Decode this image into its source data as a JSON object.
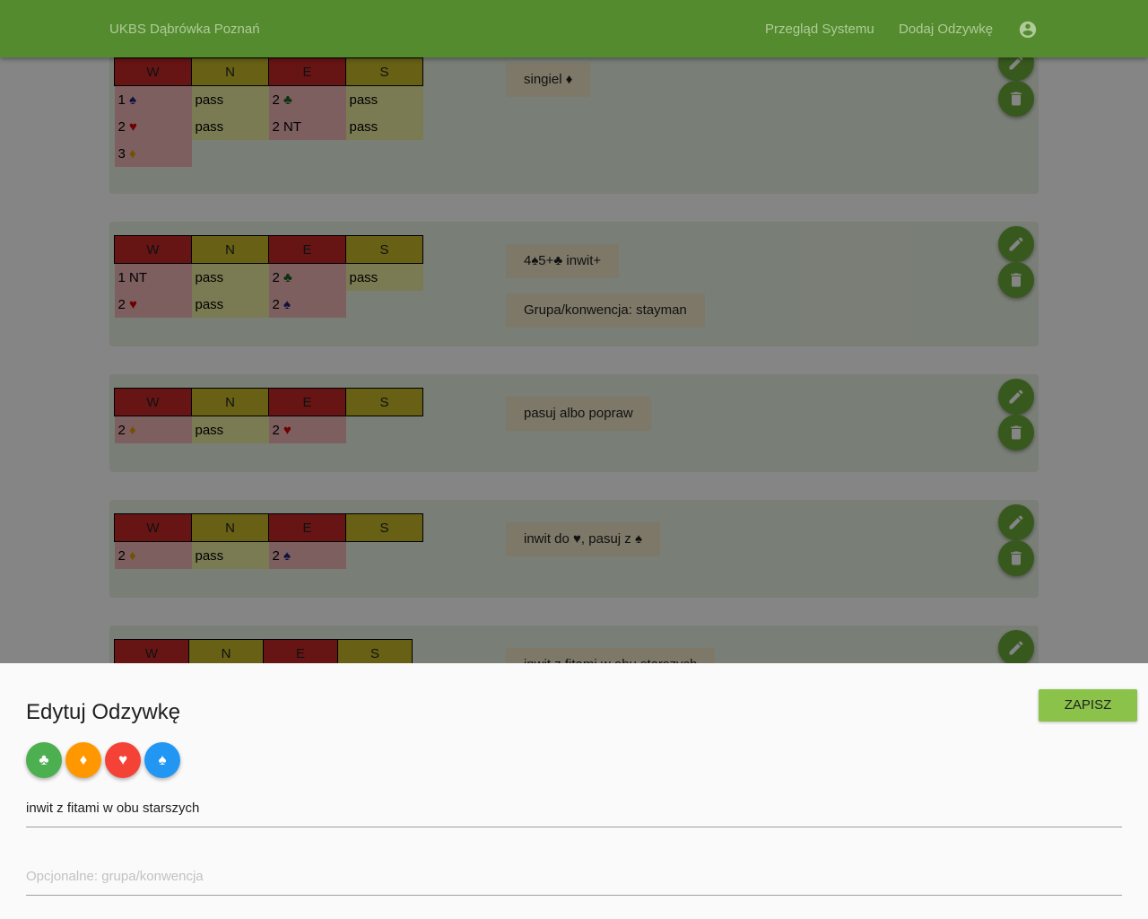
{
  "header": {
    "brand": "UKBS Dąbrówka Poznań",
    "nav": [
      "Przegląd Systemu",
      "Dodaj Odzywkę"
    ],
    "account_icon": "account-circle-icon"
  },
  "cards": [
    {
      "headers": [
        "W",
        "N",
        "E",
        "S"
      ],
      "rows": [
        [
          {
            "t": "1",
            "s": "♠",
            "c": "s"
          },
          {
            "t": "pass"
          },
          {
            "t": "2",
            "s": "♣",
            "c": "c"
          },
          {
            "t": "pass"
          }
        ],
        [
          {
            "t": "2",
            "s": "♥",
            "c": "h"
          },
          {
            "t": "pass"
          },
          {
            "t": "2 NT"
          },
          {
            "t": "pass"
          }
        ],
        [
          {
            "t": "3",
            "s": "♦",
            "c": "d"
          },
          null,
          null,
          null
        ]
      ],
      "chips": [
        "singiel ♦"
      ]
    },
    {
      "headers": [
        "W",
        "N",
        "E",
        "S"
      ],
      "rows": [
        [
          {
            "t": "1 NT"
          },
          {
            "t": "pass"
          },
          {
            "t": "2",
            "s": "♣",
            "c": "c"
          },
          {
            "t": "pass"
          }
        ],
        [
          {
            "t": "2",
            "s": "♥",
            "c": "h"
          },
          {
            "t": "pass"
          },
          {
            "t": "2",
            "s": "♠",
            "c": "s"
          },
          null
        ]
      ],
      "chips": [
        "4♠5+♣ inwit+",
        "Grupa/konwencja: stayman"
      ]
    },
    {
      "headers": [
        "W",
        "N",
        "E",
        "S"
      ],
      "rows": [
        [
          {
            "t": "2",
            "s": "♦",
            "c": "d"
          },
          {
            "t": "pass"
          },
          {
            "t": "2",
            "s": "♥",
            "c": "h"
          },
          null
        ]
      ],
      "chips": [
        "pasuj albo popraw"
      ]
    },
    {
      "headers": [
        "W",
        "N",
        "E",
        "S"
      ],
      "rows": [
        [
          {
            "t": "2",
            "s": "♦",
            "c": "d"
          },
          {
            "t": "pass"
          },
          {
            "t": "2",
            "s": "♠",
            "c": "s"
          },
          null
        ]
      ],
      "chips": [
        "inwit do ♥, pasuj z ♠"
      ]
    },
    {
      "headers": [
        "W",
        "N",
        "E",
        "S"
      ],
      "rows": [],
      "chips": [
        "inwit z fitami w obu starszych"
      ]
    }
  ],
  "sheet": {
    "title": "Edytuj Odzywkę",
    "save_label": "ZAPISZ",
    "suits": [
      {
        "symbol": "♣",
        "color": "#4caf50",
        "icon": "club-icon"
      },
      {
        "symbol": "♦",
        "color": "#ff9800",
        "icon": "diamond-icon"
      },
      {
        "symbol": "♥",
        "color": "#f44336",
        "icon": "heart-icon"
      },
      {
        "symbol": "♠",
        "color": "#2196f3",
        "icon": "spade-icon"
      }
    ],
    "meaning_value": "inwit z fitami w obu starszych",
    "group_placeholder": "Opcjonalne: grupa/konwencja",
    "group_value": ""
  }
}
